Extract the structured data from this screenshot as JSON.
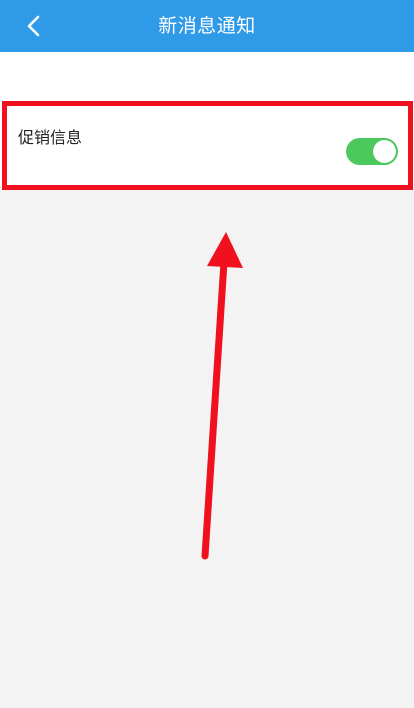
{
  "header": {
    "title": "新消息通知",
    "back_icon": "chevron-left-icon",
    "background_color": "#2f9be8"
  },
  "settings": {
    "items": [
      {
        "label": "促销信息",
        "toggle_on": true,
        "toggle_color": "#4bc95d"
      }
    ]
  },
  "annotation": {
    "highlight_color": "#f0101e",
    "arrow_icon": "up-arrow-annotation"
  }
}
